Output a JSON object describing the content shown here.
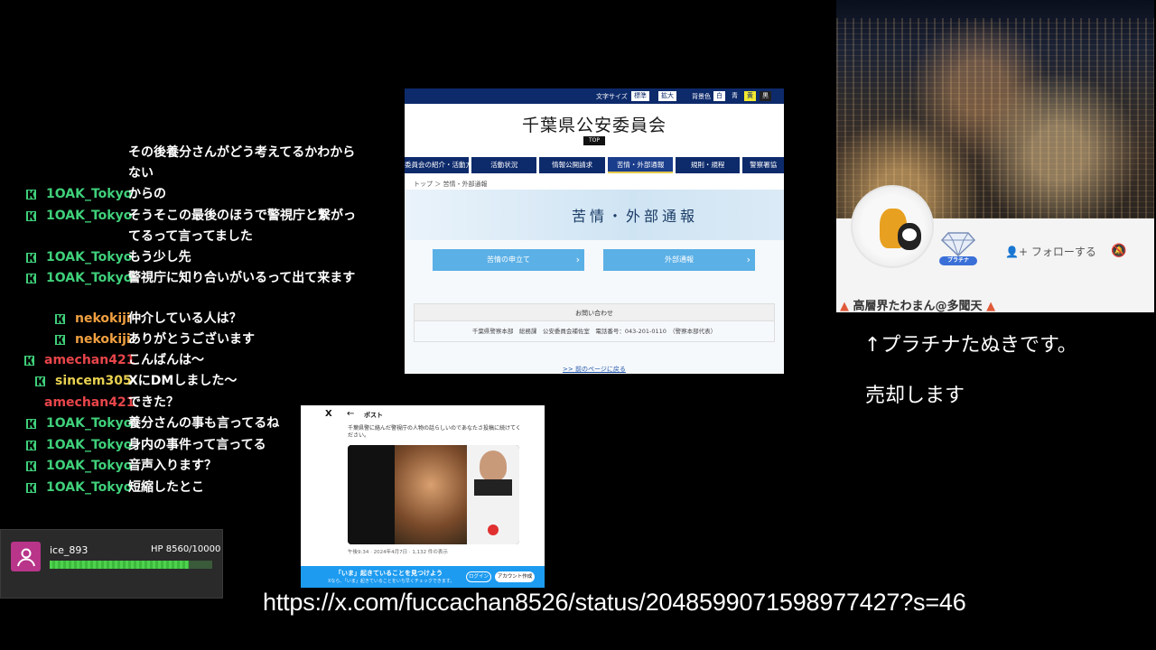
{
  "chat": {
    "messages": [
      {
        "user": "",
        "color": "",
        "text": "その後養分さんがどう考えてるかわからない"
      },
      {
        "user": "1OAK_Tokyo",
        "color": "green",
        "text": "からの"
      },
      {
        "user": "1OAK_Tokyo",
        "color": "green",
        "text": "そうそこの最後のほうで警視庁と繋がってるって言ってました"
      },
      {
        "user": "1OAK_Tokyo",
        "color": "green",
        "text": "もう少し先"
      },
      {
        "user": "1OAK_Tokyo",
        "color": "green",
        "text": "警視庁に知り合いがいるって出て来ます"
      },
      {
        "user": "nekokiji",
        "color": "orange",
        "text": "仲介している人は？"
      },
      {
        "user": "nekokiji",
        "color": "orange",
        "text": "ありがとうございます"
      },
      {
        "user": "amechan421",
        "color": "red",
        "text": "こんばんは〜"
      },
      {
        "user": "sincem305",
        "color": "yellow",
        "text": "XにDMしました〜"
      },
      {
        "user": "amechan421",
        "color": "red",
        "text": "できた？"
      },
      {
        "user": "1OAK_Tokyo",
        "color": "green",
        "text": "養分さんの事も言ってるね"
      },
      {
        "user": "1OAK_Tokyo",
        "color": "green",
        "text": "身内の事件って言ってる"
      },
      {
        "user": "1OAK_Tokyo",
        "color": "green",
        "text": "音声入ります？"
      },
      {
        "user": "1OAK_Tokyo",
        "color": "green",
        "text": "短縮したとこ"
      }
    ]
  },
  "chiba_page": {
    "font_size_label": "文字サイズ",
    "font_std": "標準",
    "font_large": "拡大",
    "bg_label": "背景色",
    "bg_white": "白",
    "bg_blue": "青",
    "bg_yellow": "黄",
    "bg_black": "黒",
    "site_title": "千葉県公安委員会",
    "top_chip": "TOP",
    "nav": [
      "委員会の紹介・活動方針",
      "活動状況",
      "情報公開請求",
      "苦情・外部通報",
      "規則・規程",
      "警察署協"
    ],
    "breadcrumb": "トップ ＞ 苦情・外部通報",
    "hero_title": "苦情・外部通報",
    "btn_complaint": "苦情の申立て",
    "btn_external": "外部通報",
    "contact_head": "お問い合わせ",
    "contact_body": "千葉県警察本部　総務課　公安委員会補佐室　電話番号：043-201-0110　（警察本部代表）",
    "back_link": ">> 前のページに戻る"
  },
  "x_post": {
    "logo": "X",
    "back": "←",
    "header": "ポスト",
    "body": "千葉県警に絡んだ警視庁の人物の話らしいのであなたさ投稿に続けてください。",
    "meta": "午後9:34 · 2024年4月7日 · 1,132 件の表示",
    "banner_title": "「いま」起きていることを見つけよう",
    "banner_sub": "Xなら、「いま」起きていることをいち早くチェックできます。",
    "login": "ログイン",
    "signup": "アカウント作成"
  },
  "user_card": {
    "name": "ice_893",
    "hp_text": "HP 8560/10000",
    "hp_fraction": 0.856
  },
  "profile": {
    "badge": "プラチナ",
    "follow": "フォローする",
    "name": "高層界たわまん@多聞天"
  },
  "captions": {
    "line1": "↑プラチナたぬきです。",
    "line2": "売却します"
  },
  "url": "https://x.com/fuccachan8526/status/2048599071598977427?s=46",
  "colors": {
    "green": "#3fd07a",
    "orange": "#f0a040",
    "red": "#e8454a",
    "yellow": "#e8d050",
    "navy": "#0d2a6b",
    "button_blue": "#5bb0e6"
  }
}
